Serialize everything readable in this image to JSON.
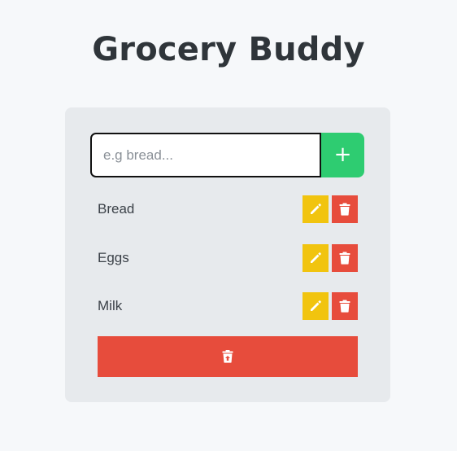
{
  "app": {
    "title": "Grocery Buddy"
  },
  "form": {
    "placeholder": "e.g bread...",
    "value": "",
    "add_icon": "plus-icon",
    "add_label": "+"
  },
  "items": [
    {
      "label": "Bread",
      "edit_icon": "pencil-icon",
      "delete_icon": "trash-icon"
    },
    {
      "label": "Eggs",
      "edit_icon": "pencil-icon",
      "delete_icon": "trash-icon"
    },
    {
      "label": "Milk",
      "edit_icon": "pencil-icon",
      "delete_icon": "trash-icon"
    }
  ],
  "clear": {
    "icon": "trash-restore-icon"
  },
  "colors": {
    "background": "#f6f8fa",
    "card": "#e7eaed",
    "title": "#2f353a",
    "add": "#2ecc71",
    "edit": "#f1c40f",
    "delete": "#e74c3c"
  }
}
